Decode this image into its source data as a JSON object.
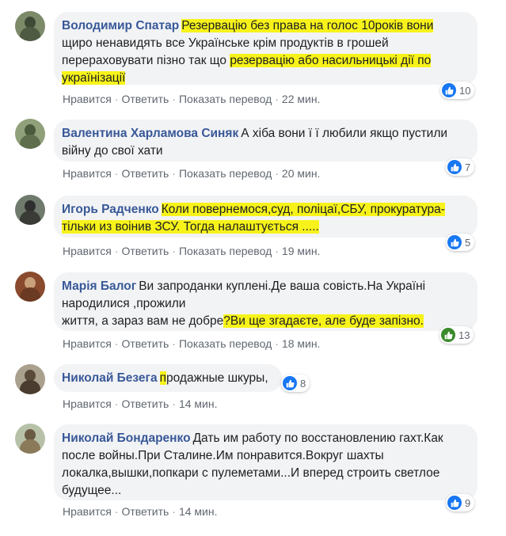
{
  "actions": {
    "like": "Нравится",
    "reply": "Ответить",
    "translate": "Показать перевод"
  },
  "comments": [
    {
      "name": "Володимир Спатар",
      "text_1": "Резервацію без права на голос 10років вони",
      "text_2": "щиро ненавидять все Українське крім продуктів в грошей",
      "text_3a": "перераховувати пізно так що ",
      "text_3b": "резервацію або насильницькі дії по",
      "text_4": "українізації",
      "time": "22 мин.",
      "likes": "10",
      "avatar_colors": [
        "#7d8a6a",
        "#3e4a36"
      ]
    },
    {
      "name": "Валентина Харламова Синяк",
      "text_1": "А хіба вони ї ї любили якщо пустили",
      "text_2": "війну до свої хати",
      "time": "20 мин.",
      "likes": "7",
      "avatar_colors": [
        "#8fa07a",
        "#4a5a3c"
      ]
    },
    {
      "name": "Игорь Радченко",
      "text_1": "Коли повернемося,суд, поліцаї,СБУ, прокуратура-",
      "text_2": "тільки из воінив ЗСУ. Тогда налаштується .....",
      "time": "19 мин.",
      "likes": "5",
      "avatar_colors": [
        "#6f7a6c",
        "#2f2f2f"
      ]
    },
    {
      "name": "Марія Балог",
      "text_1": "Ви запроданки куплені.Де ваша совість.На Україні",
      "text_2": "народилися ,прожили",
      "text_3a": "життя, а зараз вам не добре",
      "text_3b": "?Ви ще згадаєте, але буде запізно.",
      "time": "18 мин.",
      "likes": "13",
      "avatar_colors": [
        "#8a4a2e",
        "#c9a17a"
      ]
    },
    {
      "name": "Николай Безега",
      "text_1a": "п",
      "text_1b": "родажные шкуры,",
      "time": "14 мин.",
      "likes": "8",
      "avatar_colors": [
        "#a9a08e",
        "#5a4a3a"
      ]
    },
    {
      "name": "Николай Бондаренко",
      "text_1": "Дать им работу по восстановлению гахт.Как",
      "text_2": "после войны.При Сталине.Им понравится.Вокруг шахты",
      "text_3": "локалка,вышки,попкари с пулеметами...И вперед строить светлое",
      "text_4": "будущее...",
      "time": "14 мин.",
      "likes": "9",
      "avatar_colors": [
        "#b7c1a8",
        "#6a5a44"
      ]
    }
  ],
  "colors": {
    "name": "#385898",
    "bubble": "#f2f3f5",
    "highlight": "#f7f31a",
    "like_blue": "#1877f2",
    "meta": "#606770"
  },
  "icons": {
    "reaction": "like-thumb-icon"
  }
}
